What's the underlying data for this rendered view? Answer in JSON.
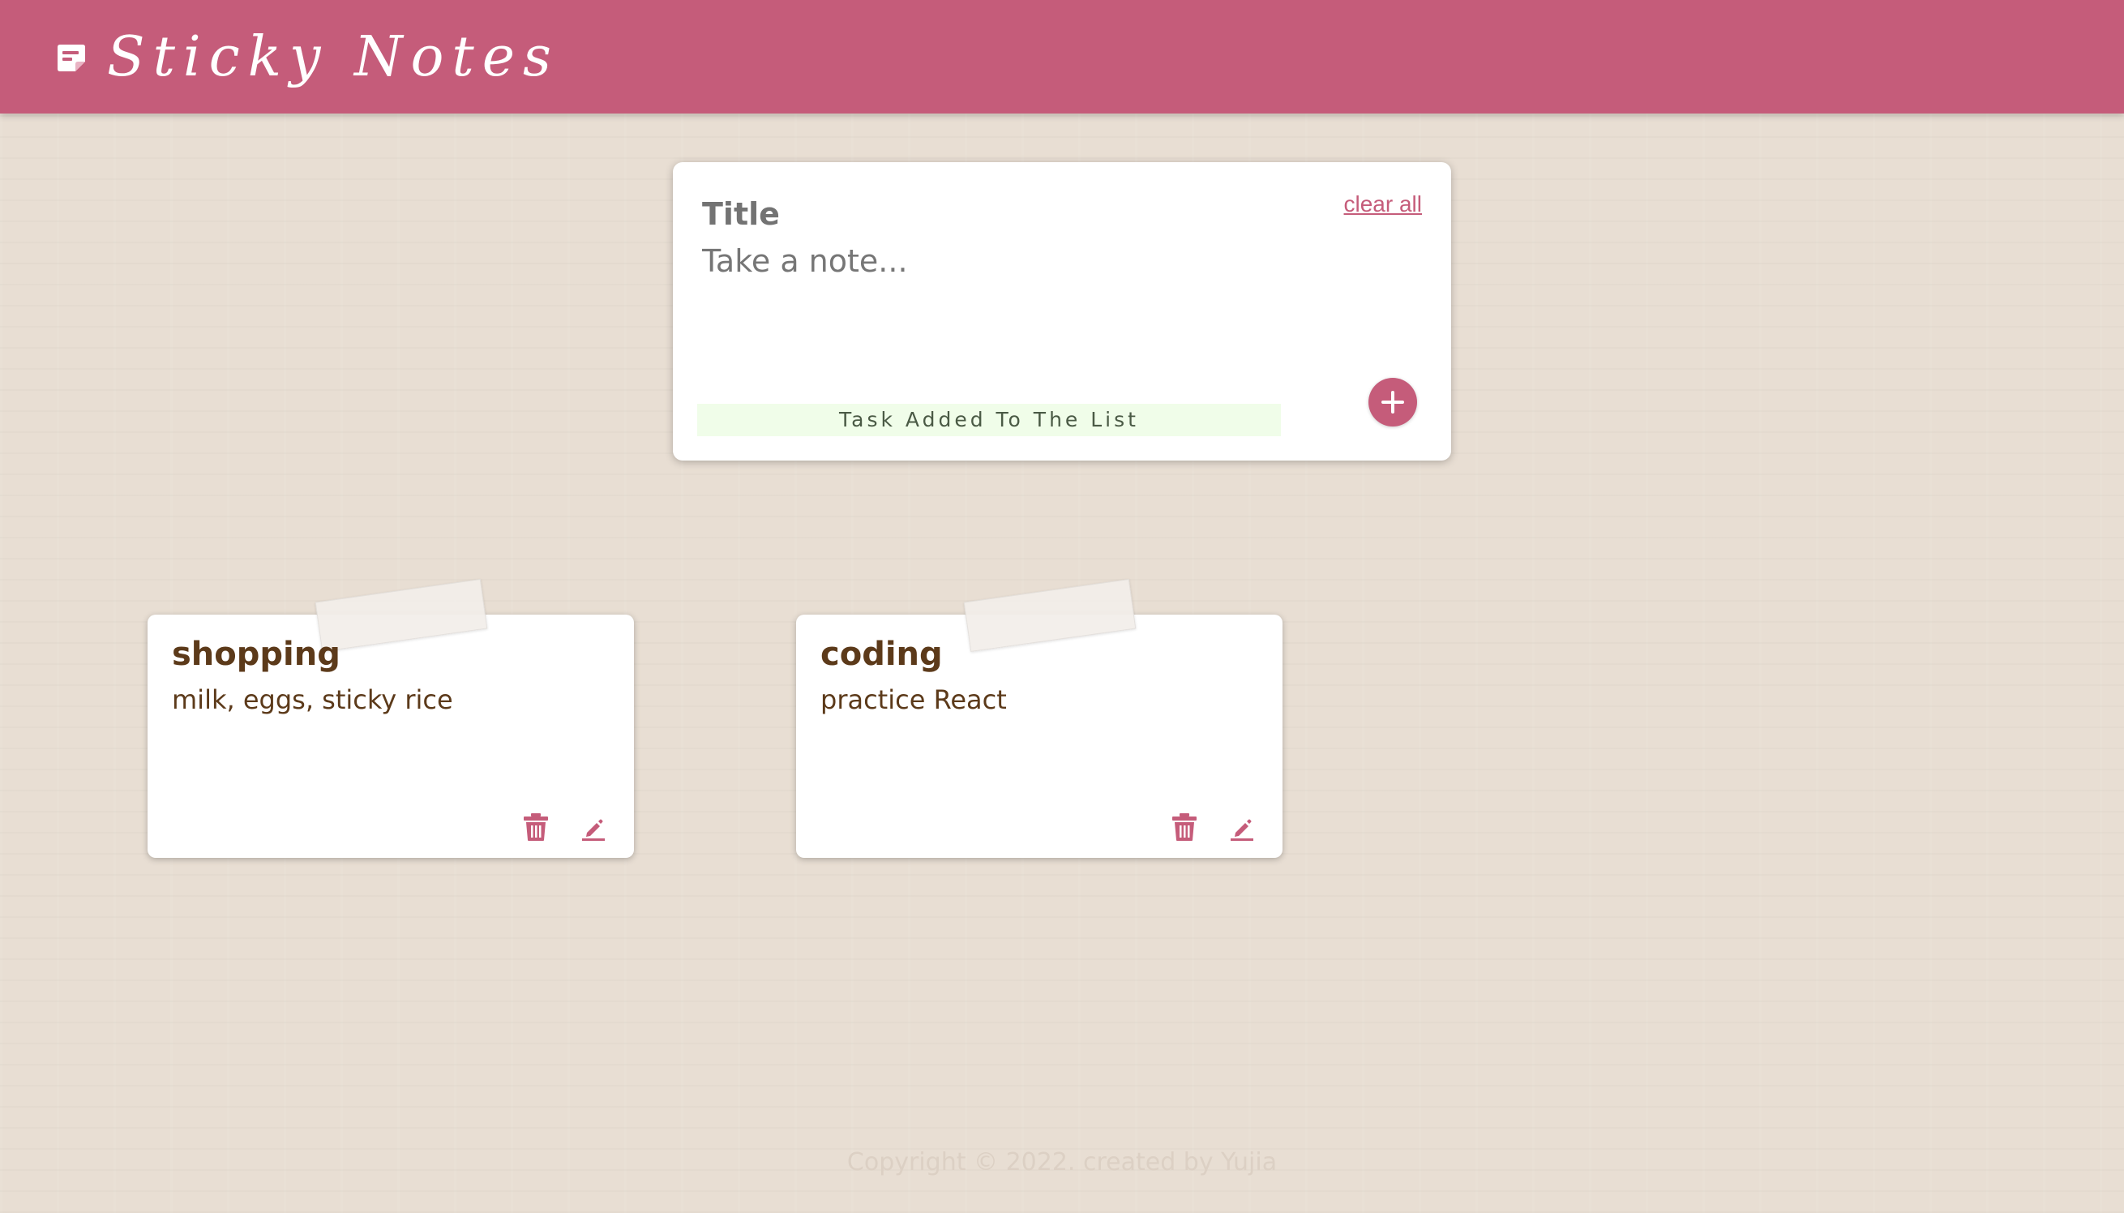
{
  "app": {
    "title": "Sticky Notes",
    "logo_icon": "sticky-note-icon",
    "accent_color": "#c55c7a"
  },
  "create_form": {
    "title_placeholder": "Title",
    "content_placeholder": "Take a note...",
    "clear_all_label": "clear all",
    "status_message": "Task Added To The List",
    "add_icon": "plus-icon"
  },
  "notes": [
    {
      "title": "shopping",
      "content": "milk, eggs, sticky rice",
      "delete_icon": "trash-icon",
      "edit_icon": "pencil-icon"
    },
    {
      "title": "coding",
      "content": "practice React",
      "delete_icon": "trash-icon",
      "edit_icon": "pencil-icon"
    }
  ],
  "footer": {
    "text": "Copyright © 2022. created by Yujia"
  }
}
